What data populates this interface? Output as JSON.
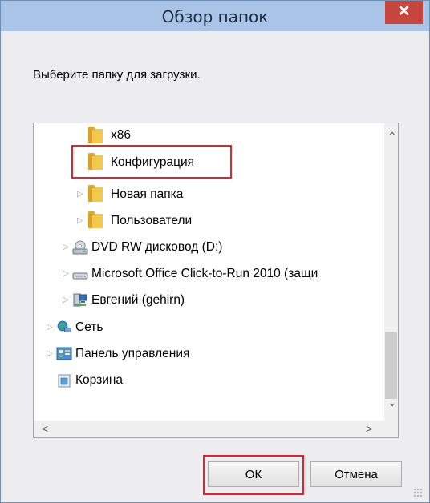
{
  "window": {
    "title": "Обзор папок",
    "close_glyph": "✕"
  },
  "prompt": "Выберите папку для загрузки.",
  "tree": {
    "items": [
      {
        "label": "x86",
        "icon": "folder-icon",
        "expander": ""
      },
      {
        "label": "Конфигурация",
        "icon": "folder-icon",
        "expander": "",
        "selected": true
      },
      {
        "label": "Новая папка",
        "icon": "folder-icon",
        "expander": "▷"
      },
      {
        "label": "Пользователи",
        "icon": "folder-icon",
        "expander": "▷"
      },
      {
        "label": "DVD RW дисковод (D:)",
        "icon": "dvd-drive-icon",
        "expander": "▷"
      },
      {
        "label": "Microsoft Office Click-to-Run 2010 (защи",
        "icon": "drive-icon",
        "expander": "▷"
      },
      {
        "label": "Евгений (gehirn)",
        "icon": "network-computer-icon",
        "expander": "▷"
      },
      {
        "label": "Сеть",
        "icon": "network-icon",
        "expander": "▷"
      },
      {
        "label": "Панель управления",
        "icon": "control-panel-icon",
        "expander": "▷"
      },
      {
        "label": "Корзина",
        "icon": "recycle-bin-icon",
        "expander": ""
      }
    ]
  },
  "scroll": {
    "up": "⌃",
    "down": "⌄",
    "left": "<",
    "right": ">"
  },
  "buttons": {
    "ok": "ОК",
    "cancel": "Отмена"
  },
  "colors": {
    "highlight": "#e2232b",
    "titlebar": "#a9c4e6",
    "close": "#c8463e"
  }
}
